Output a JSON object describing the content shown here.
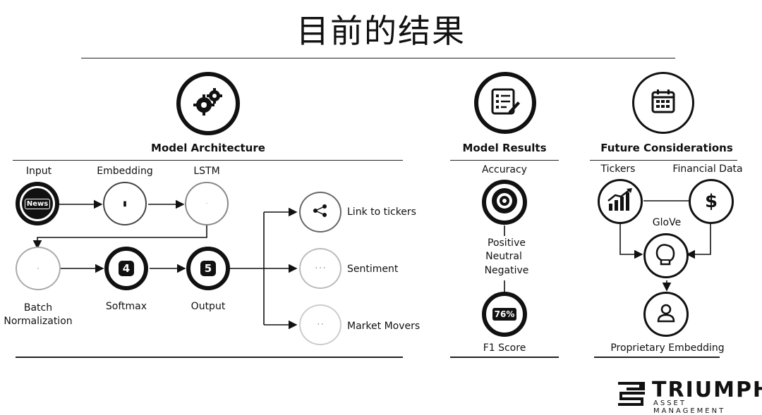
{
  "title": "目前的结果",
  "sections": {
    "architecture": "Model Architecture",
    "results": "Model Results",
    "future": "Future Considerations"
  },
  "architecture": {
    "input_label": "Input",
    "input_badge": "News",
    "embedding_label": "Embedding",
    "lstm_label": "LSTM",
    "batch_label_1": "Batch",
    "batch_label_2": "Normalization",
    "softmax_label": "Softmax",
    "softmax_num": "4",
    "output_label": "Output",
    "output_num": "5",
    "outputs": [
      "Link to tickers",
      "Sentiment",
      "Market Movers"
    ]
  },
  "results": {
    "accuracy_label": "Accuracy",
    "classes": [
      "Positive",
      "Neutral",
      "Negative"
    ],
    "f1_value": "76%",
    "f1_label": "F1 Score"
  },
  "future": {
    "tickers_label": "Tickers",
    "financial_label": "Financial Data",
    "dollar": "$",
    "glove_label": "GloVe",
    "proprietary_label": "Proprietary Embedding"
  },
  "logo": {
    "name": "TRIUMPH",
    "sub": "ASSET MANAGEMENT"
  },
  "icons": [
    "gears-icon",
    "checklist-icon",
    "calendar-icon",
    "news-icon",
    "target-icon",
    "growth-chart-icon",
    "dollar-icon",
    "boxing-glove-icon",
    "user-icon",
    "share-icon"
  ]
}
